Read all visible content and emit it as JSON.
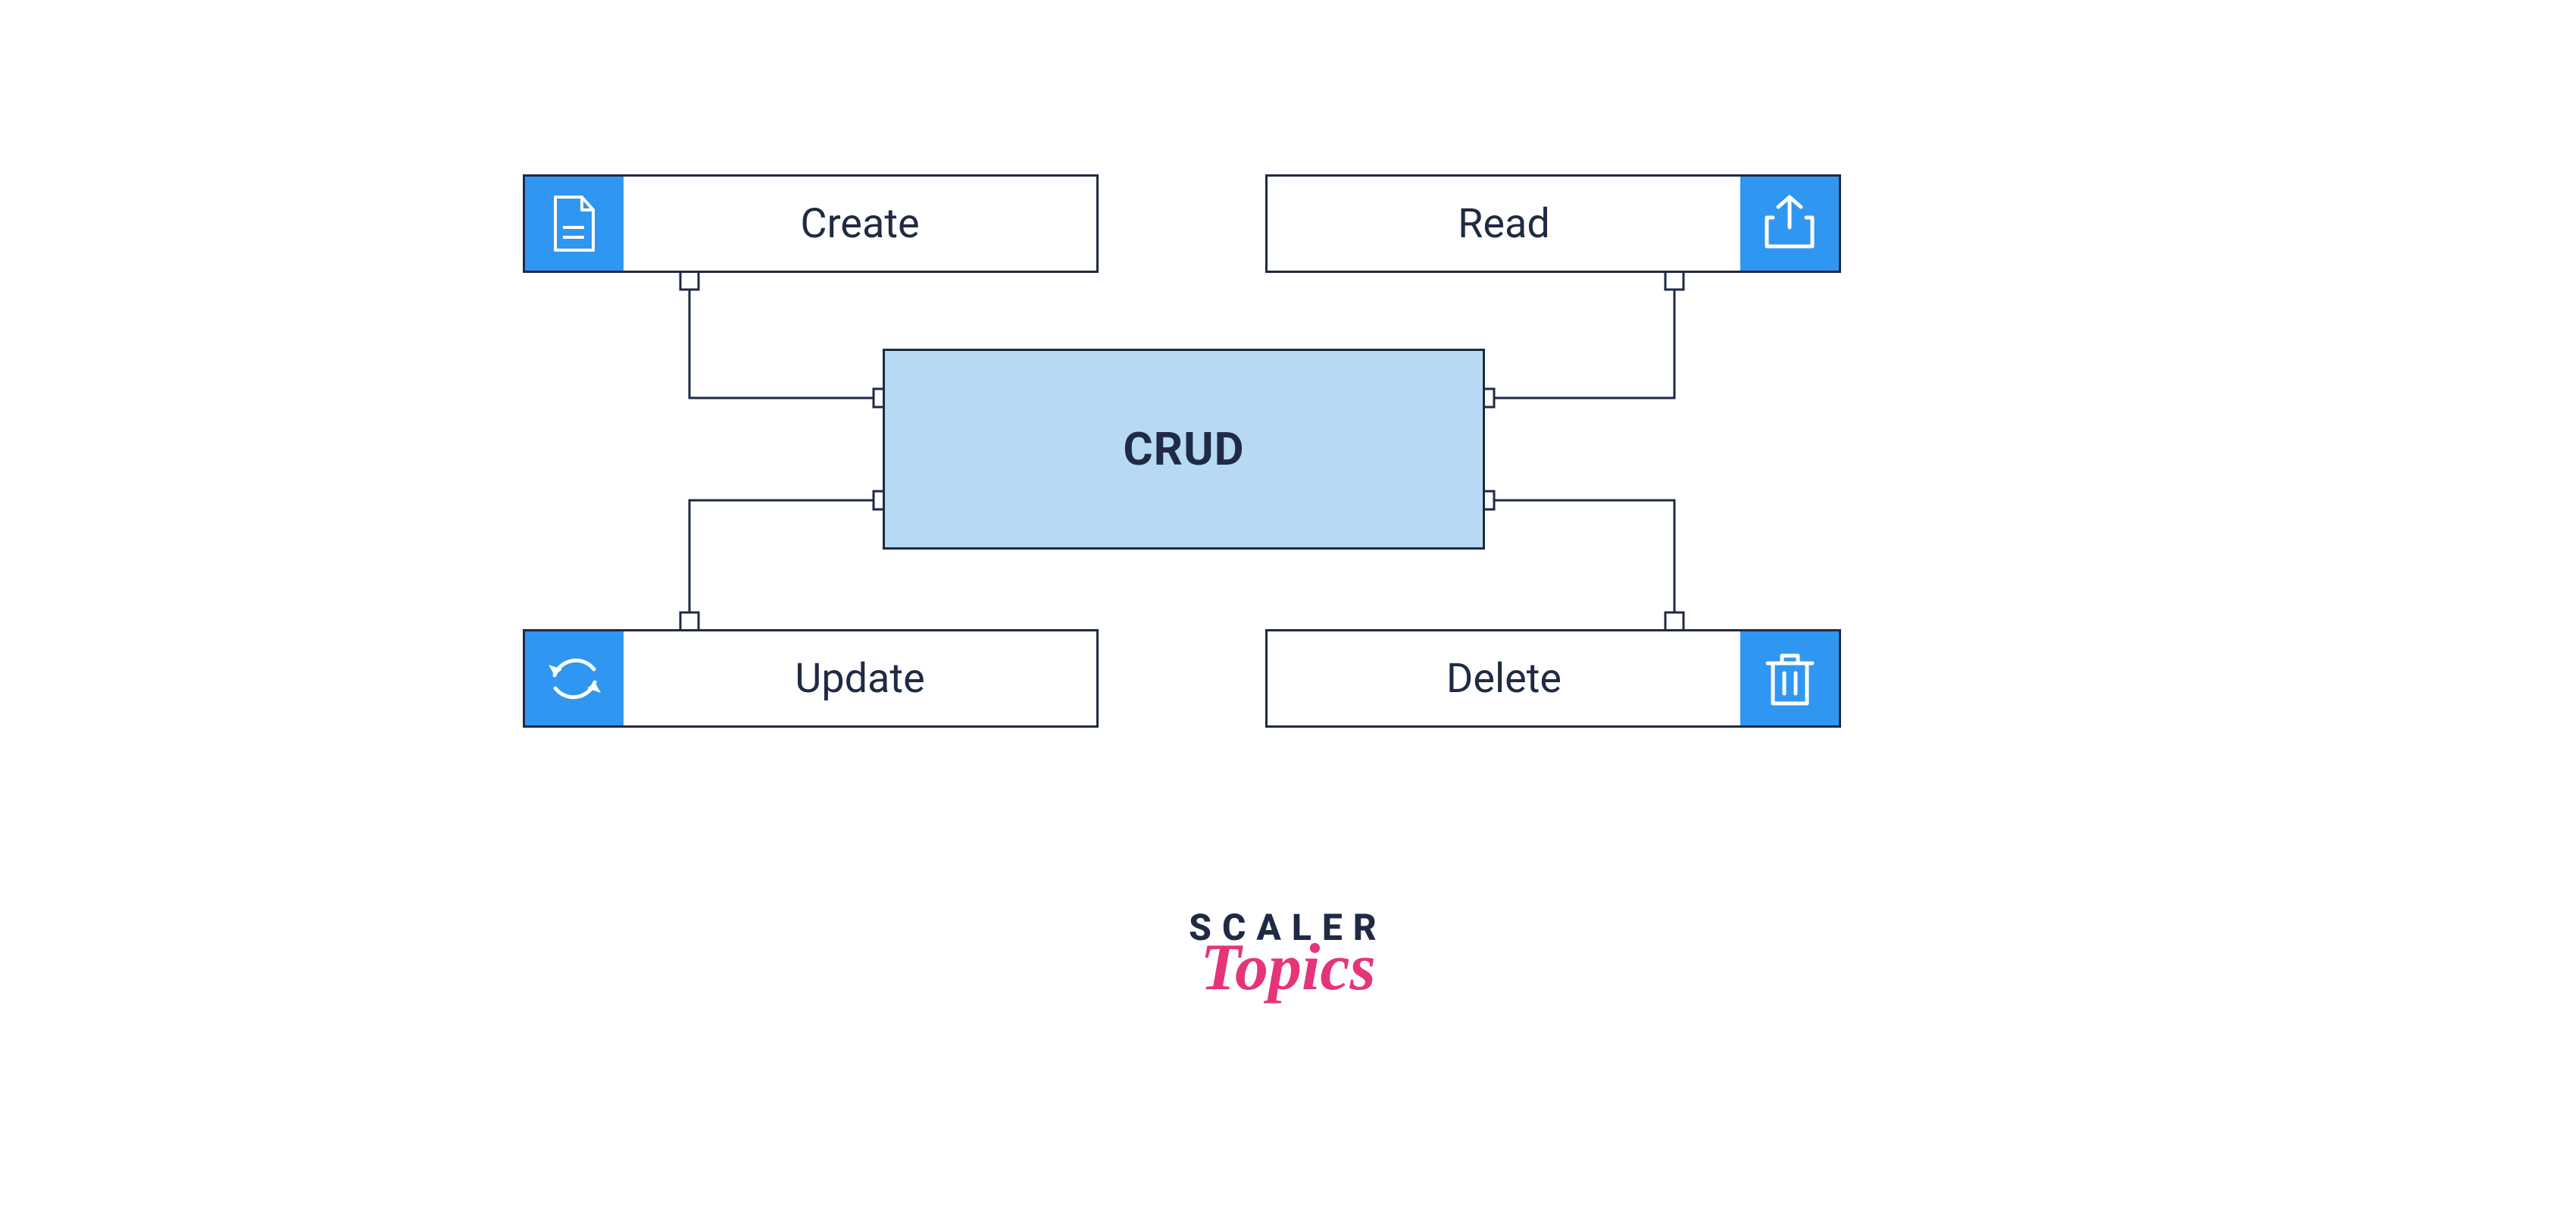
{
  "diagram": {
    "center_label": "CRUD",
    "nodes": {
      "create": {
        "label": "Create",
        "icon": "document-icon"
      },
      "read": {
        "label": "Read",
        "icon": "share-up-icon"
      },
      "update": {
        "label": "Update",
        "icon": "refresh-icon"
      },
      "delete": {
        "label": "Delete",
        "icon": "trash-icon"
      }
    }
  },
  "branding": {
    "line1": "SCALER",
    "line2": "Topics"
  },
  "colors": {
    "outline": "#1f2a44",
    "icon_bg": "#2f97f1",
    "center_bg": "#b6daf4",
    "accent_pink": "#e6347a"
  }
}
